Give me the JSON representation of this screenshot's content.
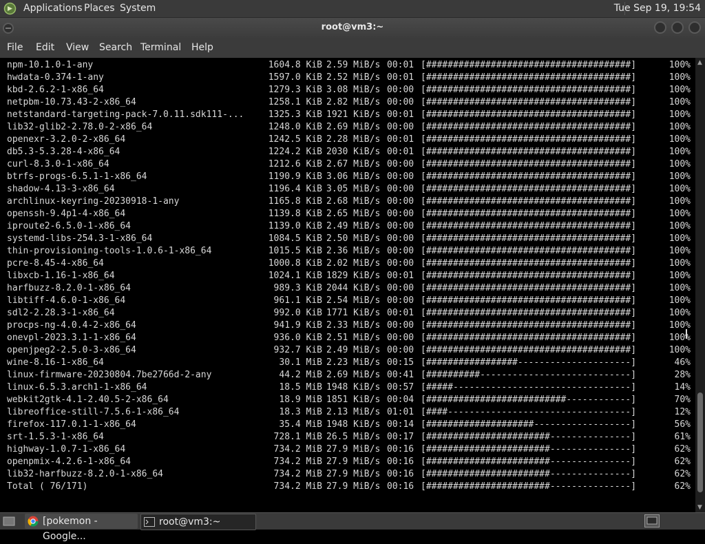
{
  "top_panel": {
    "menu": [
      "Applications",
      "Places",
      "System"
    ],
    "clock": "Tue Sep 19, 19:54"
  },
  "window": {
    "title": "root@vm3:~",
    "menubar": [
      "File",
      "Edit",
      "View",
      "Search",
      "Terminal",
      "Help"
    ]
  },
  "terminal": {
    "lines": [
      {
        "name": "npm-10.1.0-1-any",
        "size": "1604.8 KiB",
        "rate": "2.59 MiB/s",
        "time": "00:01",
        "bar": "[######################################]",
        "pct": "100%"
      },
      {
        "name": "hwdata-0.374-1-any",
        "size": "1597.0 KiB",
        "rate": "2.52 MiB/s",
        "time": "00:01",
        "bar": "[######################################]",
        "pct": "100%"
      },
      {
        "name": "kbd-2.6.2-1-x86_64",
        "size": "1279.3 KiB",
        "rate": "3.08 MiB/s",
        "time": "00:00",
        "bar": "[######################################]",
        "pct": "100%"
      },
      {
        "name": "netpbm-10.73.43-2-x86_64",
        "size": "1258.1 KiB",
        "rate": "2.82 MiB/s",
        "time": "00:00",
        "bar": "[######################################]",
        "pct": "100%"
      },
      {
        "name": "netstandard-targeting-pack-7.0.11.sdk111-...",
        "size": "1325.3 KiB",
        "rate": "1921 KiB/s",
        "time": "00:01",
        "bar": "[######################################]",
        "pct": "100%"
      },
      {
        "name": "lib32-glib2-2.78.0-2-x86_64",
        "size": "1248.0 KiB",
        "rate": "2.69 MiB/s",
        "time": "00:00",
        "bar": "[######################################]",
        "pct": "100%"
      },
      {
        "name": "openexr-3.2.0-2-x86_64",
        "size": "1242.5 KiB",
        "rate": "2.28 MiB/s",
        "time": "00:01",
        "bar": "[######################################]",
        "pct": "100%"
      },
      {
        "name": "db5.3-5.3.28-4-x86_64",
        "size": "1224.2 KiB",
        "rate": "2030 KiB/s",
        "time": "00:01",
        "bar": "[######################################]",
        "pct": "100%"
      },
      {
        "name": "curl-8.3.0-1-x86_64",
        "size": "1212.6 KiB",
        "rate": "2.67 MiB/s",
        "time": "00:00",
        "bar": "[######################################]",
        "pct": "100%"
      },
      {
        "name": "btrfs-progs-6.5.1-1-x86_64",
        "size": "1190.9 KiB",
        "rate": "3.06 MiB/s",
        "time": "00:00",
        "bar": "[######################################]",
        "pct": "100%"
      },
      {
        "name": "shadow-4.13-3-x86_64",
        "size": "1196.4 KiB",
        "rate": "3.05 MiB/s",
        "time": "00:00",
        "bar": "[######################################]",
        "pct": "100%"
      },
      {
        "name": "archlinux-keyring-20230918-1-any",
        "size": "1165.8 KiB",
        "rate": "2.68 MiB/s",
        "time": "00:00",
        "bar": "[######################################]",
        "pct": "100%"
      },
      {
        "name": "openssh-9.4p1-4-x86_64",
        "size": "1139.8 KiB",
        "rate": "2.65 MiB/s",
        "time": "00:00",
        "bar": "[######################################]",
        "pct": "100%"
      },
      {
        "name": "iproute2-6.5.0-1-x86_64",
        "size": "1139.0 KiB",
        "rate": "2.49 MiB/s",
        "time": "00:00",
        "bar": "[######################################]",
        "pct": "100%"
      },
      {
        "name": "systemd-libs-254.3-1-x86_64",
        "size": "1084.5 KiB",
        "rate": "2.50 MiB/s",
        "time": "00:00",
        "bar": "[######################################]",
        "pct": "100%"
      },
      {
        "name": "thin-provisioning-tools-1.0.6-1-x86_64",
        "size": "1015.5 KiB",
        "rate": "2.36 MiB/s",
        "time": "00:00",
        "bar": "[######################################]",
        "pct": "100%"
      },
      {
        "name": "pcre-8.45-4-x86_64",
        "size": "1000.8 KiB",
        "rate": "2.02 MiB/s",
        "time": "00:00",
        "bar": "[######################################]",
        "pct": "100%"
      },
      {
        "name": "libxcb-1.16-1-x86_64",
        "size": "1024.1 KiB",
        "rate": "1829 KiB/s",
        "time": "00:01",
        "bar": "[######################################]",
        "pct": "100%"
      },
      {
        "name": "harfbuzz-8.2.0-1-x86_64",
        "size": "989.3 KiB",
        "rate": "2044 KiB/s",
        "time": "00:00",
        "bar": "[######################################]",
        "pct": "100%"
      },
      {
        "name": "libtiff-4.6.0-1-x86_64",
        "size": "961.1 KiB",
        "rate": "2.54 MiB/s",
        "time": "00:00",
        "bar": "[######################################]",
        "pct": "100%"
      },
      {
        "name": "sdl2-2.28.3-1-x86_64",
        "size": "992.0 KiB",
        "rate": "1771 KiB/s",
        "time": "00:01",
        "bar": "[######################################]",
        "pct": "100%"
      },
      {
        "name": "procps-ng-4.0.4-2-x86_64",
        "size": "941.9 KiB",
        "rate": "2.33 MiB/s",
        "time": "00:00",
        "bar": "[######################################]",
        "pct": "100%"
      },
      {
        "name": "onevpl-2023.3.1-1-x86_64",
        "size": "936.0 KiB",
        "rate": "2.51 MiB/s",
        "time": "00:00",
        "bar": "[######################################]",
        "pct": "100%"
      },
      {
        "name": "openjpeg2-2.5.0-3-x86_64",
        "size": "932.7 KiB",
        "rate": "2.49 MiB/s",
        "time": "00:00",
        "bar": "[######################################]",
        "pct": "100%"
      },
      {
        "name": "wine-8.16-1-x86_64",
        "size": "30.1 MiB",
        "rate": "2.23 MiB/s",
        "time": "00:15",
        "bar": "[#################---------------------]",
        "pct": "46%"
      },
      {
        "name": "linux-firmware-20230804.7be2766d-2-any",
        "size": "44.2 MiB",
        "rate": "2.69 MiB/s",
        "time": "00:41",
        "bar": "[##########----------------------------]",
        "pct": "28%"
      },
      {
        "name": "linux-6.5.3.arch1-1-x86_64",
        "size": "18.5 MiB",
        "rate": "1948 KiB/s",
        "time": "00:57",
        "bar": "[#####---------------------------------]",
        "pct": "14%"
      },
      {
        "name": "webkit2gtk-4.1-2.40.5-2-x86_64",
        "size": "18.9 MiB",
        "rate": "1851 KiB/s",
        "time": "00:04",
        "bar": "[##########################------------]",
        "pct": "70%"
      },
      {
        "name": "libreoffice-still-7.5.6-1-x86_64",
        "size": "18.3 MiB",
        "rate": "2.13 MiB/s",
        "time": "01:01",
        "bar": "[####----------------------------------]",
        "pct": "12%"
      },
      {
        "name": "firefox-117.0.1-1-x86_64",
        "size": "35.4 MiB",
        "rate": "1948 KiB/s",
        "time": "00:14",
        "bar": "[####################------------------]",
        "pct": "56%"
      },
      {
        "name": "srt-1.5.3-1-x86_64",
        "size": "728.1 MiB",
        "rate": "26.5 MiB/s",
        "time": "00:17",
        "bar": "[#######################---------------]",
        "pct": "61%"
      },
      {
        "name": "highway-1.0.7-1-x86_64",
        "size": "734.2 MiB",
        "rate": "27.9 MiB/s",
        "time": "00:16",
        "bar": "[#######################---------------]",
        "pct": "62%"
      },
      {
        "name": "openpmix-4.2.6-1-x86_64",
        "size": "734.2 MiB",
        "rate": "27.9 MiB/s",
        "time": "00:16",
        "bar": "[#######################---------------]",
        "pct": "62%"
      },
      {
        "name": "lib32-harfbuzz-8.2.0-1-x86_64",
        "size": "734.2 MiB",
        "rate": "27.9 MiB/s",
        "time": "00:16",
        "bar": "[#######################---------------]",
        "pct": "62%"
      },
      {
        "name": "Total ( 76/171)",
        "size": "734.2 MiB",
        "rate": "27.9 MiB/s",
        "time": "00:16",
        "bar": "[#######################---------------]",
        "pct": "62%"
      }
    ]
  },
  "taskbar": {
    "tasks": [
      {
        "label": "[pokemon - Google...",
        "icon": "chrome-icon"
      },
      {
        "label": "root@vm3:~",
        "icon": "terminal-icon"
      }
    ]
  },
  "colors": {
    "panel": "#3a3a3a",
    "terminal_bg": "#000000",
    "terminal_fg": "#d8d8d8"
  }
}
